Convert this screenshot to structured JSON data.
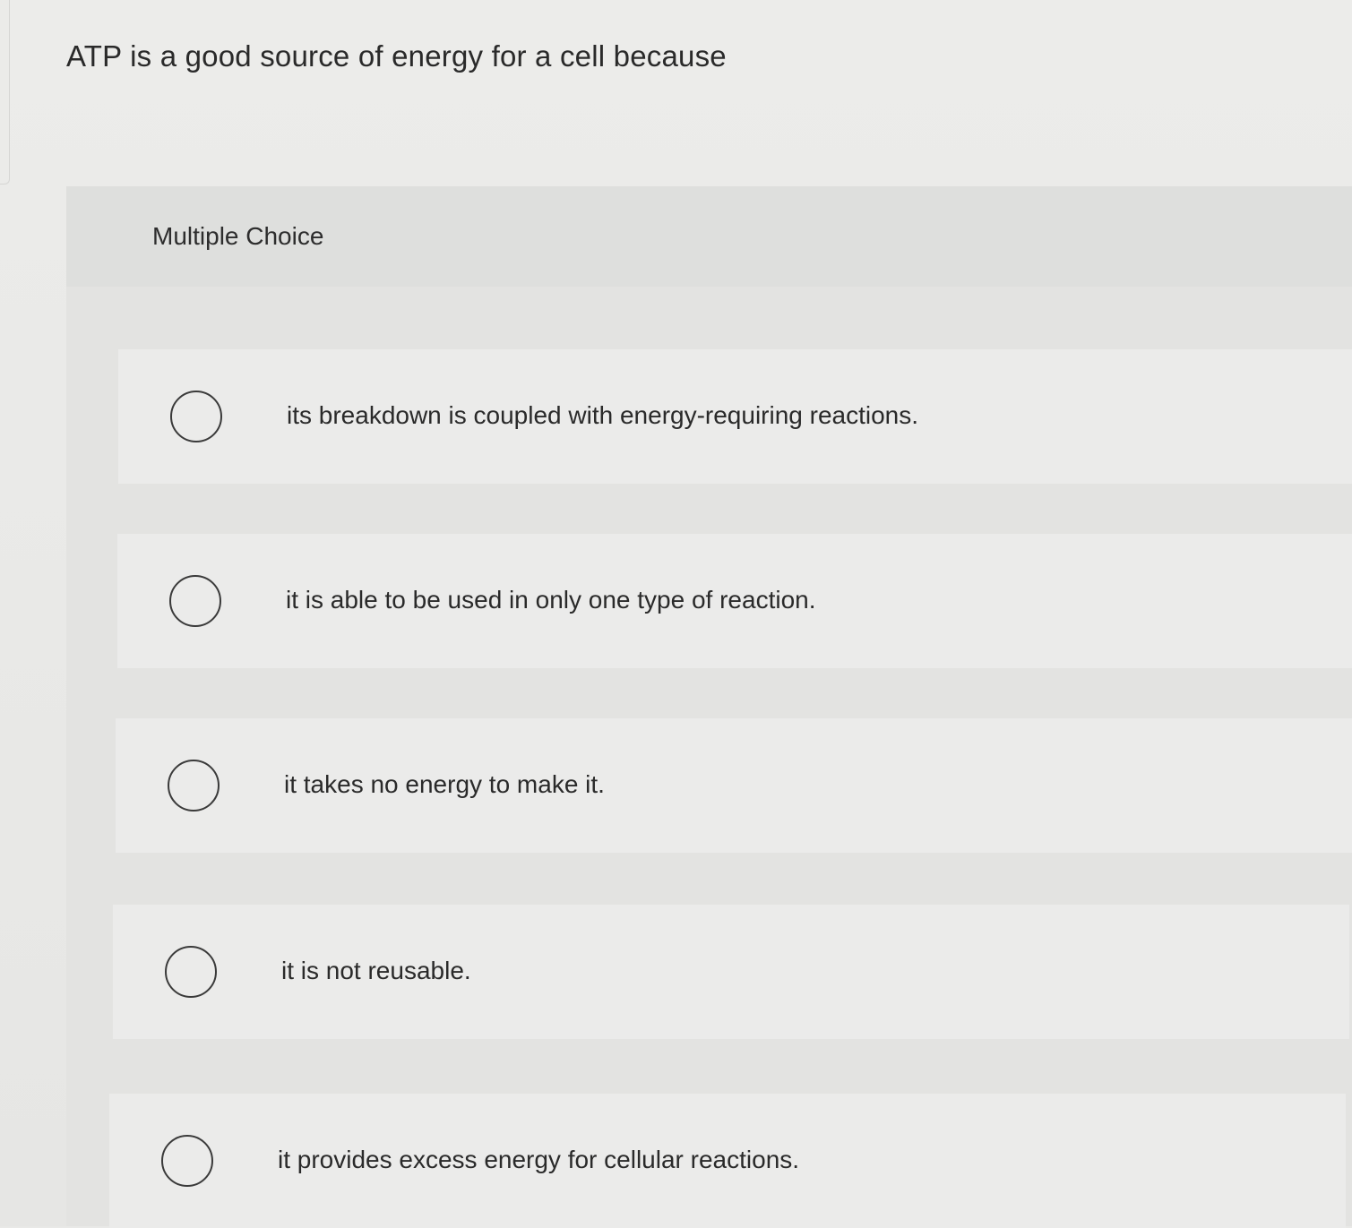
{
  "question": {
    "text": "ATP is a good source of energy for a cell because"
  },
  "choice_section": {
    "type_label": "Multiple Choice",
    "options": [
      {
        "label": "its breakdown is coupled with energy-requiring reactions.",
        "selected": false
      },
      {
        "label": "it is able to be used in only one type of reaction.",
        "selected": false
      },
      {
        "label": "it takes no energy to make it.",
        "selected": false
      },
      {
        "label": "it is not reusable.",
        "selected": false
      },
      {
        "label": "it provides excess energy for cellular reactions.",
        "selected": false
      }
    ]
  }
}
